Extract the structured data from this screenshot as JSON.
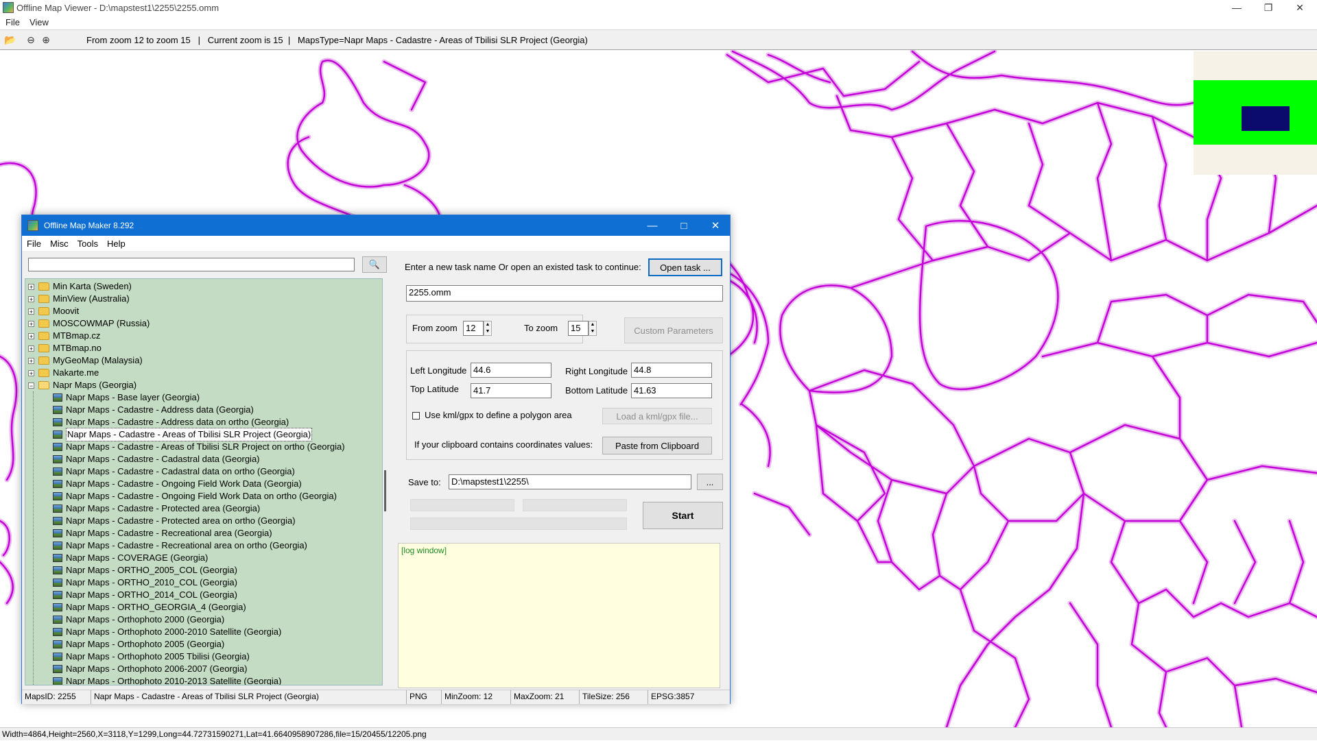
{
  "viewer": {
    "title": "Offline Map Viewer - D:\\mapstest1\\2255\\2255.omm",
    "menu": [
      "File",
      "View"
    ],
    "toolbar_info": "From zoom 12 to zoom 15   |   Current zoom is 15  |   MapsType=Napr Maps - Cadastre - Areas of Tbilisi SLR Project (Georgia)",
    "status": "Width=4864,Height=2560,X=3118,Y=1299,Long=44.72731590271,Lat=41.6640958907286,file=15/20455/12205.png",
    "icons": [
      "folder-open-icon",
      "zoom-out-icon",
      "zoom-in-icon"
    ]
  },
  "dialog": {
    "title": "Offline Map Maker 8.292",
    "menu": [
      "File",
      "Misc",
      "Tools",
      "Help"
    ],
    "search_value": "",
    "tree": [
      {
        "label": "Min Karta (Sweden)",
        "type": "folder"
      },
      {
        "label": "MinView (Australia)",
        "type": "folder"
      },
      {
        "label": "Moovit",
        "type": "folder"
      },
      {
        "label": "MOSCOWMAP (Russia)",
        "type": "folder"
      },
      {
        "label": "MTBmap.cz",
        "type": "folder"
      },
      {
        "label": "MTBmap.no",
        "type": "folder"
      },
      {
        "label": "MyGeoMap (Malaysia)",
        "type": "folder"
      },
      {
        "label": "Nakarte.me",
        "type": "folder"
      },
      {
        "label": "Napr Maps (Georgia)",
        "type": "folder-open"
      },
      {
        "label": "Napr Maps - Base layer (Georgia)",
        "type": "map"
      },
      {
        "label": "Napr Maps - Cadastre - Address data (Georgia)",
        "type": "map"
      },
      {
        "label": "Napr Maps - Cadastre - Address data on ortho (Georgia)",
        "type": "map"
      },
      {
        "label": "Napr Maps - Cadastre - Areas of Tbilisi SLR Project (Georgia)",
        "type": "map",
        "selected": true
      },
      {
        "label": "Napr Maps - Cadastre - Areas of Tbilisi SLR Project on ortho (Georgia)",
        "type": "map"
      },
      {
        "label": "Napr Maps - Cadastre - Cadastral data (Georgia)",
        "type": "map"
      },
      {
        "label": "Napr Maps - Cadastre - Cadastral data on ortho (Georgia)",
        "type": "map"
      },
      {
        "label": "Napr Maps - Cadastre - Ongoing Field Work Data (Georgia)",
        "type": "map"
      },
      {
        "label": "Napr Maps - Cadastre - Ongoing Field Work Data on ortho (Georgia)",
        "type": "map"
      },
      {
        "label": "Napr Maps - Cadastre - Protected area (Georgia)",
        "type": "map"
      },
      {
        "label": "Napr Maps - Cadastre - Protected area on ortho (Georgia)",
        "type": "map"
      },
      {
        "label": "Napr Maps - Cadastre - Recreational area (Georgia)",
        "type": "map"
      },
      {
        "label": "Napr Maps - Cadastre - Recreational area on ortho (Georgia)",
        "type": "map"
      },
      {
        "label": "Napr Maps - COVERAGE (Georgia)",
        "type": "map"
      },
      {
        "label": "Napr Maps - ORTHO_2005_COL (Georgia)",
        "type": "map"
      },
      {
        "label": "Napr Maps - ORTHO_2010_COL (Georgia)",
        "type": "map"
      },
      {
        "label": "Napr Maps - ORTHO_2014_COL (Georgia)",
        "type": "map"
      },
      {
        "label": "Napr Maps - ORTHO_GEORGIA_4 (Georgia)",
        "type": "map"
      },
      {
        "label": "Napr Maps - Orthophoto 2000 (Georgia)",
        "type": "map"
      },
      {
        "label": "Napr Maps - Orthophoto 2000-2010 Satellite (Georgia)",
        "type": "map"
      },
      {
        "label": "Napr Maps - Orthophoto 2005 (Georgia)",
        "type": "map"
      },
      {
        "label": "Napr Maps - Orthophoto 2005 Tbilisi (Georgia)",
        "type": "map"
      },
      {
        "label": "Napr Maps - Orthophoto 2006-2007 (Georgia)",
        "type": "map"
      },
      {
        "label": "Napr Maps - Orthophoto 2010-2013 Satellite (Georgia)",
        "type": "map"
      }
    ],
    "task_prompt": "Enter a new task name Or open an existed task to continue:",
    "open_task_label": "Open task ...",
    "task_name": "2255.omm",
    "from_zoom_label": "From zoom",
    "from_zoom_value": "12",
    "to_zoom_label": "To zoom",
    "to_zoom_value": "15",
    "custom_params_label": "Custom Parameters",
    "left_lon_label": "Left Longitude",
    "left_lon_value": "44.6",
    "right_lon_label": "Right Longitude",
    "right_lon_value": "44.8",
    "top_lat_label": "Top Latitude",
    "top_lat_value": "41.7",
    "bottom_lat_label": "Bottom Latitude",
    "bottom_lat_value": "41.63",
    "kml_checkbox_label": "Use kml/gpx to define a polygon area",
    "kml_checked": false,
    "load_kml_label": "Load a kml/gpx file...",
    "clipboard_prompt": "If your clipboard contains coordinates values:",
    "paste_label": "Paste from Clipboard",
    "save_to_label": "Save to:",
    "save_to_value": "D:\\mapstest1\\2255\\",
    "browse_label": "...",
    "start_label": "Start",
    "log_text": "[log window]",
    "status": {
      "maps_id": "MapsID: 2255",
      "maps_name": "Napr Maps - Cadastre - Areas of Tbilisi SLR Project (Georgia)",
      "format": "PNG",
      "min_zoom": "MinZoom: 12",
      "max_zoom": "MaxZoom: 21",
      "tile_size": "TileSize: 256",
      "epsg": "EPSG:3857"
    }
  },
  "colors": {
    "map_line": "#c400d8",
    "map_glow": "#eab8f0",
    "overview_green": "#00ff00",
    "overview_navy": "#0b0b6e",
    "tree_bg": "#c3dcc3",
    "dialog_title": "#0f6fd2"
  }
}
